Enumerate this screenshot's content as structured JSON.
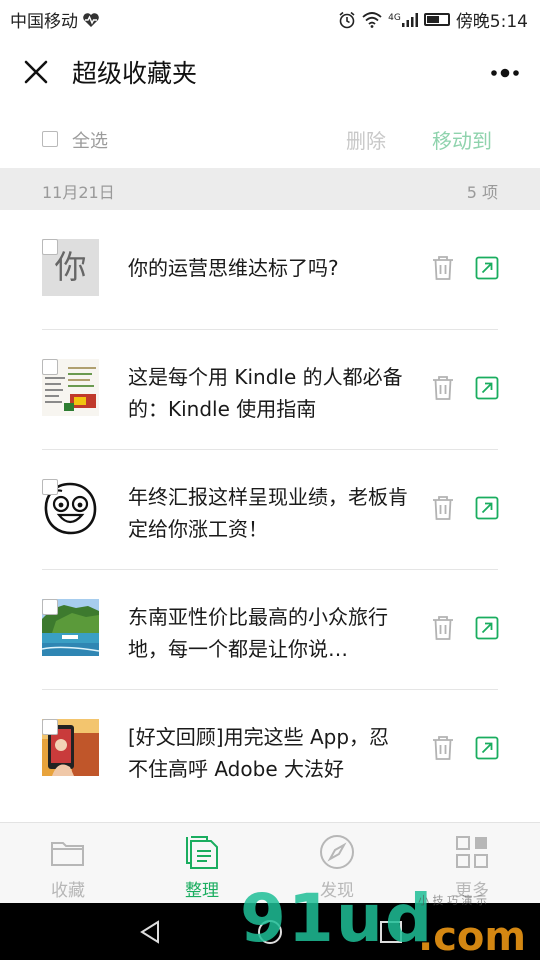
{
  "status_bar": {
    "carrier": "中国移动",
    "network": "4G",
    "time": "傍晚5:14"
  },
  "header": {
    "title": "超级收藏夹"
  },
  "actions": {
    "select_all": "全选",
    "delete": "删除",
    "move_to": "移动到"
  },
  "group": {
    "date": "11月21日",
    "count": "5 项"
  },
  "items": [
    {
      "title": "你的运营思维达标了吗?",
      "thumb_char": "你",
      "thumb": "text-thumb"
    },
    {
      "title": "这是每个用 Kindle 的人都必备的：Kindle 使用指南",
      "thumb": "document-thumb"
    },
    {
      "title": "年终汇报这样呈现业绩，老板肯定给你涨工资！",
      "thumb": "face-thumb"
    },
    {
      "title": "东南亚性价比最高的小众旅行地，每一个都是让你说…",
      "thumb": "beach-thumb"
    },
    {
      "title": "[好文回顾]用完这些 App，忍不住高呼 Adobe 大法好",
      "thumb": "photo-thumb"
    }
  ],
  "tabs": [
    {
      "label": "收藏",
      "icon": "folder-icon",
      "active": false
    },
    {
      "label": "整理",
      "icon": "organize-icon",
      "active": true
    },
    {
      "label": "发现",
      "icon": "compass-icon",
      "active": false
    },
    {
      "label": "更多",
      "icon": "grid-icon",
      "active": false
    }
  ],
  "watermark": {
    "main": "91ud",
    "suffix": ".com",
    "small": "小 技 巧 演 示"
  },
  "colors": {
    "accent": "#1aad5f",
    "accent_disabled": "#8fd3ad",
    "divider": "#e5e5e5"
  }
}
